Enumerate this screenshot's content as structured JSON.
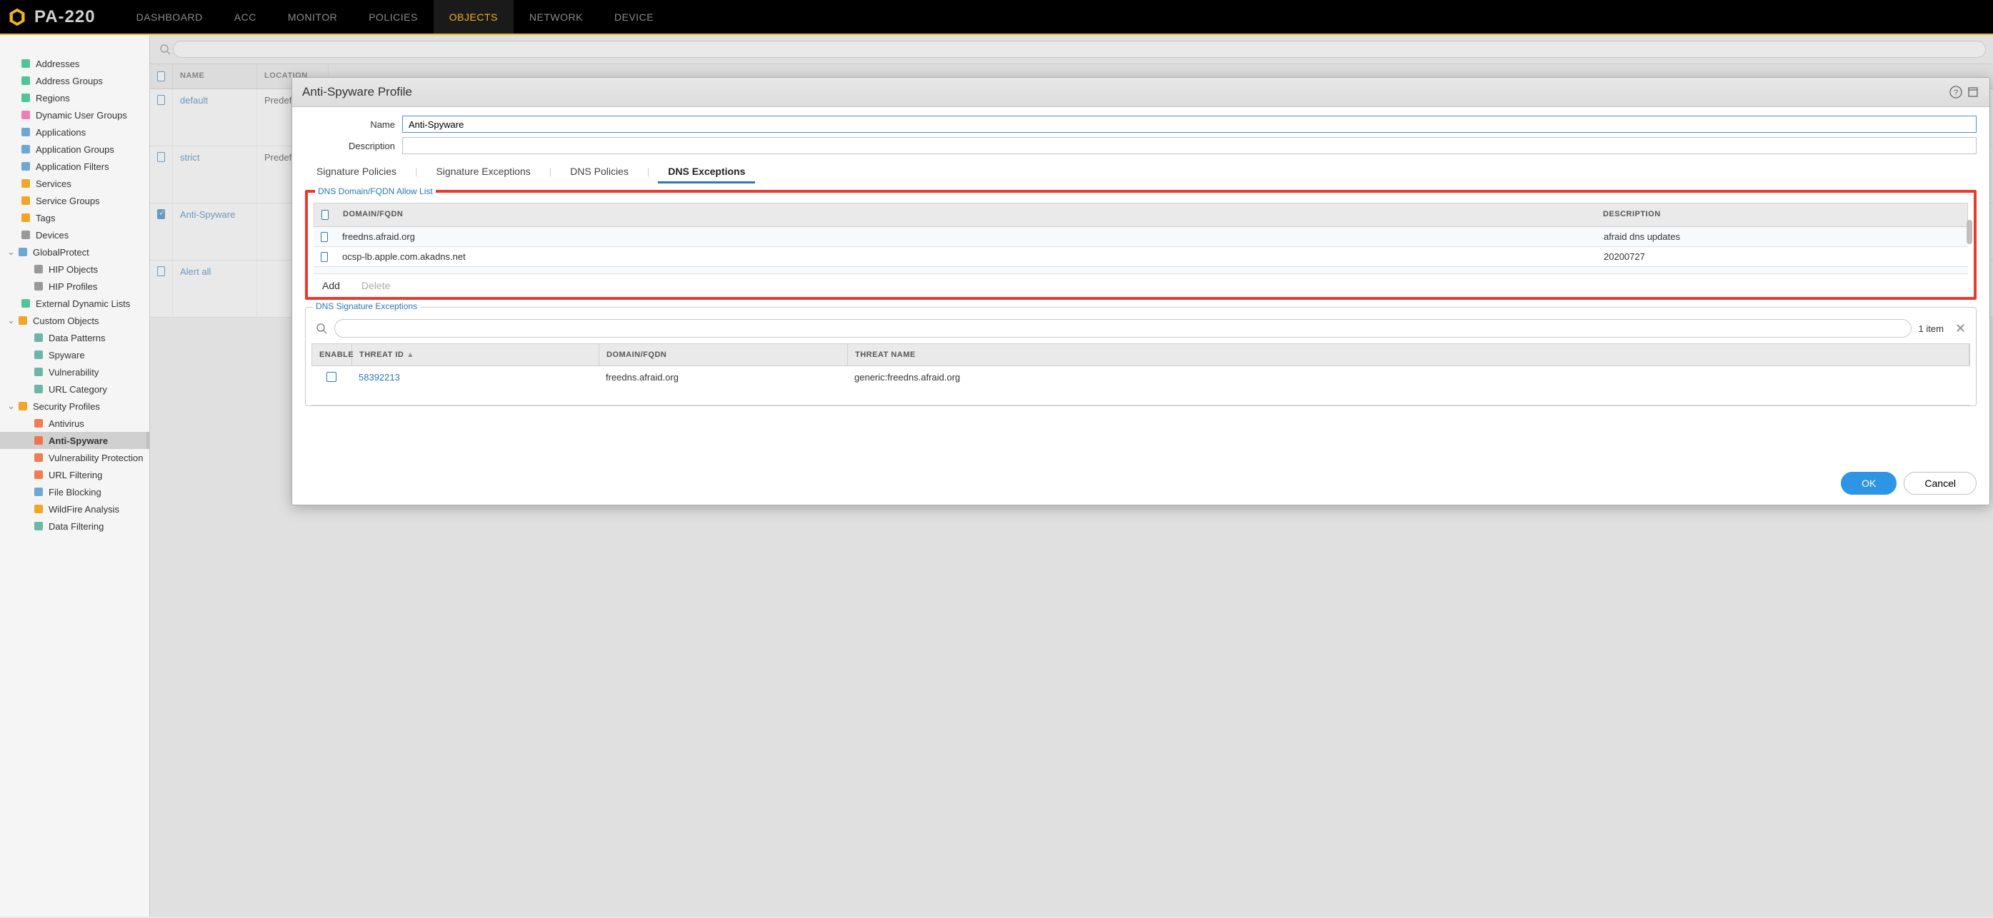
{
  "header": {
    "product": "PA-220",
    "nav": [
      "DASHBOARD",
      "ACC",
      "MONITOR",
      "POLICIES",
      "OBJECTS",
      "NETWORK",
      "DEVICE"
    ],
    "active_index": 4
  },
  "sidebar": {
    "items": [
      {
        "label": "Addresses",
        "level": 2,
        "icon": "addresses"
      },
      {
        "label": "Address Groups",
        "level": 2,
        "icon": "addrgroup"
      },
      {
        "label": "Regions",
        "level": 2,
        "icon": "regions"
      },
      {
        "label": "Dynamic User Groups",
        "level": 2,
        "icon": "dyngroup"
      },
      {
        "label": "Applications",
        "level": 2,
        "icon": "apps"
      },
      {
        "label": "Application Groups",
        "level": 2,
        "icon": "appgroup"
      },
      {
        "label": "Application Filters",
        "level": 2,
        "icon": "appfilter"
      },
      {
        "label": "Services",
        "level": 2,
        "icon": "services"
      },
      {
        "label": "Service Groups",
        "level": 2,
        "icon": "svcgroup"
      },
      {
        "label": "Tags",
        "level": 2,
        "icon": "tags"
      },
      {
        "label": "Devices",
        "level": 2,
        "icon": "devices"
      },
      {
        "label": "GlobalProtect",
        "level": 1,
        "icon": "gp",
        "expand": true
      },
      {
        "label": "HIP Objects",
        "level": 3,
        "icon": "hip"
      },
      {
        "label": "HIP Profiles",
        "level": 3,
        "icon": "hipp"
      },
      {
        "label": "External Dynamic Lists",
        "level": 2,
        "icon": "edl"
      },
      {
        "label": "Custom Objects",
        "level": 1,
        "icon": "custom",
        "expand": true
      },
      {
        "label": "Data Patterns",
        "level": 3,
        "icon": "dp"
      },
      {
        "label": "Spyware",
        "level": 3,
        "icon": "spy"
      },
      {
        "label": "Vulnerability",
        "level": 3,
        "icon": "vuln"
      },
      {
        "label": "URL Category",
        "level": 3,
        "icon": "urlc"
      },
      {
        "label": "Security Profiles",
        "level": 1,
        "icon": "sec",
        "expand": true
      },
      {
        "label": "Antivirus",
        "level": 3,
        "icon": "av"
      },
      {
        "label": "Anti-Spyware",
        "level": 3,
        "icon": "as",
        "selected": true,
        "dim": true
      },
      {
        "label": "Vulnerability Protection",
        "level": 3,
        "icon": "vp"
      },
      {
        "label": "URL Filtering",
        "level": 3,
        "icon": "urlf"
      },
      {
        "label": "File Blocking",
        "level": 3,
        "icon": "fb"
      },
      {
        "label": "WildFire Analysis",
        "level": 3,
        "icon": "wf"
      },
      {
        "label": "Data Filtering",
        "level": 3,
        "icon": "df"
      }
    ]
  },
  "grid": {
    "columns": [
      "NAME",
      "LOCATION"
    ],
    "rows": [
      {
        "name": "default",
        "location": "Predefined",
        "checked": false
      },
      {
        "name": "strict",
        "location": "Predefined",
        "checked": false
      },
      {
        "name": "Anti-Spyware",
        "location": "",
        "checked": true
      },
      {
        "name": "Alert all",
        "location": "",
        "checked": false
      }
    ]
  },
  "modal": {
    "title": "Anti-Spyware Profile",
    "name_label": "Name",
    "name_value": "Anti-Spyware",
    "desc_label": "Description",
    "desc_value": "",
    "tabs": [
      "Signature Policies",
      "Signature Exceptions",
      "DNS Policies",
      "DNS Exceptions"
    ],
    "active_tab": 3,
    "allowlist": {
      "legend": "DNS Domain/FQDN Allow List",
      "columns": [
        "DOMAIN/FQDN",
        "DESCRIPTION"
      ],
      "rows": [
        {
          "domain": "freedns.afraid.org",
          "desc": "afraid dns updates"
        },
        {
          "domain": "ocsp-lb.apple.com.akadns.net",
          "desc": "20200727"
        }
      ],
      "add_label": "Add",
      "delete_label": "Delete"
    },
    "sigex": {
      "legend": "DNS Signature Exceptions",
      "count_text": "1 item",
      "columns": [
        "ENABLE",
        "THREAT ID",
        "DOMAIN/FQDN",
        "THREAT NAME"
      ],
      "rows": [
        {
          "enabled": false,
          "threat_id": "58392213",
          "domain": "freedns.afraid.org",
          "threat_name": "generic:freedns.afraid.org"
        }
      ]
    },
    "ok_label": "OK",
    "cancel_label": "Cancel"
  }
}
